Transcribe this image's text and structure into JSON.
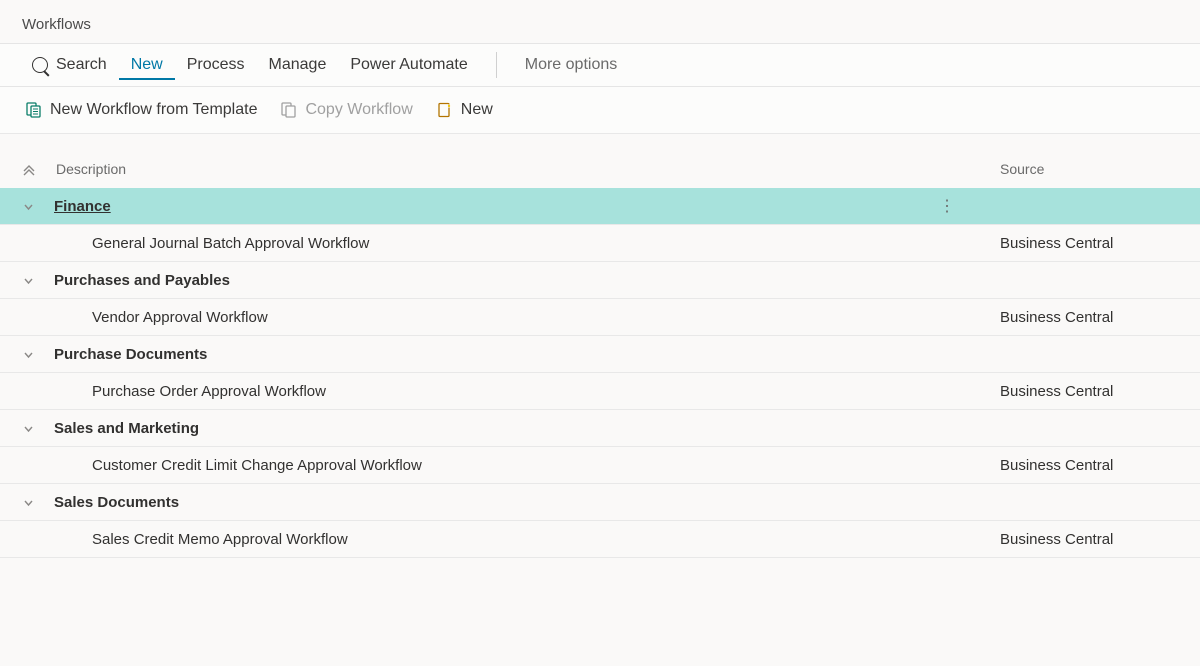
{
  "page_title": "Workflows",
  "toolbar": {
    "search": "Search",
    "new": "New",
    "process": "Process",
    "manage": "Manage",
    "power_automate": "Power Automate",
    "more_options": "More options"
  },
  "subtoolbar": {
    "new_from_template": "New Workflow from Template",
    "copy_workflow": "Copy Workflow",
    "new": "New"
  },
  "columns": {
    "description": "Description",
    "source": "Source"
  },
  "groups": [
    {
      "name": "Finance",
      "selected": true,
      "items": [
        {
          "desc": "General Journal Batch Approval Workflow",
          "source": "Business Central"
        }
      ]
    },
    {
      "name": "Purchases and Payables",
      "items": [
        {
          "desc": "Vendor Approval Workflow",
          "source": "Business Central"
        }
      ]
    },
    {
      "name": "Purchase Documents",
      "items": [
        {
          "desc": "Purchase Order Approval Workflow",
          "source": "Business Central"
        }
      ]
    },
    {
      "name": "Sales and Marketing",
      "items": [
        {
          "desc": "Customer Credit Limit Change Approval Workflow",
          "source": "Business Central"
        }
      ]
    },
    {
      "name": "Sales Documents",
      "items": [
        {
          "desc": "Sales Credit Memo Approval Workflow",
          "source": "Business Central"
        }
      ]
    }
  ]
}
